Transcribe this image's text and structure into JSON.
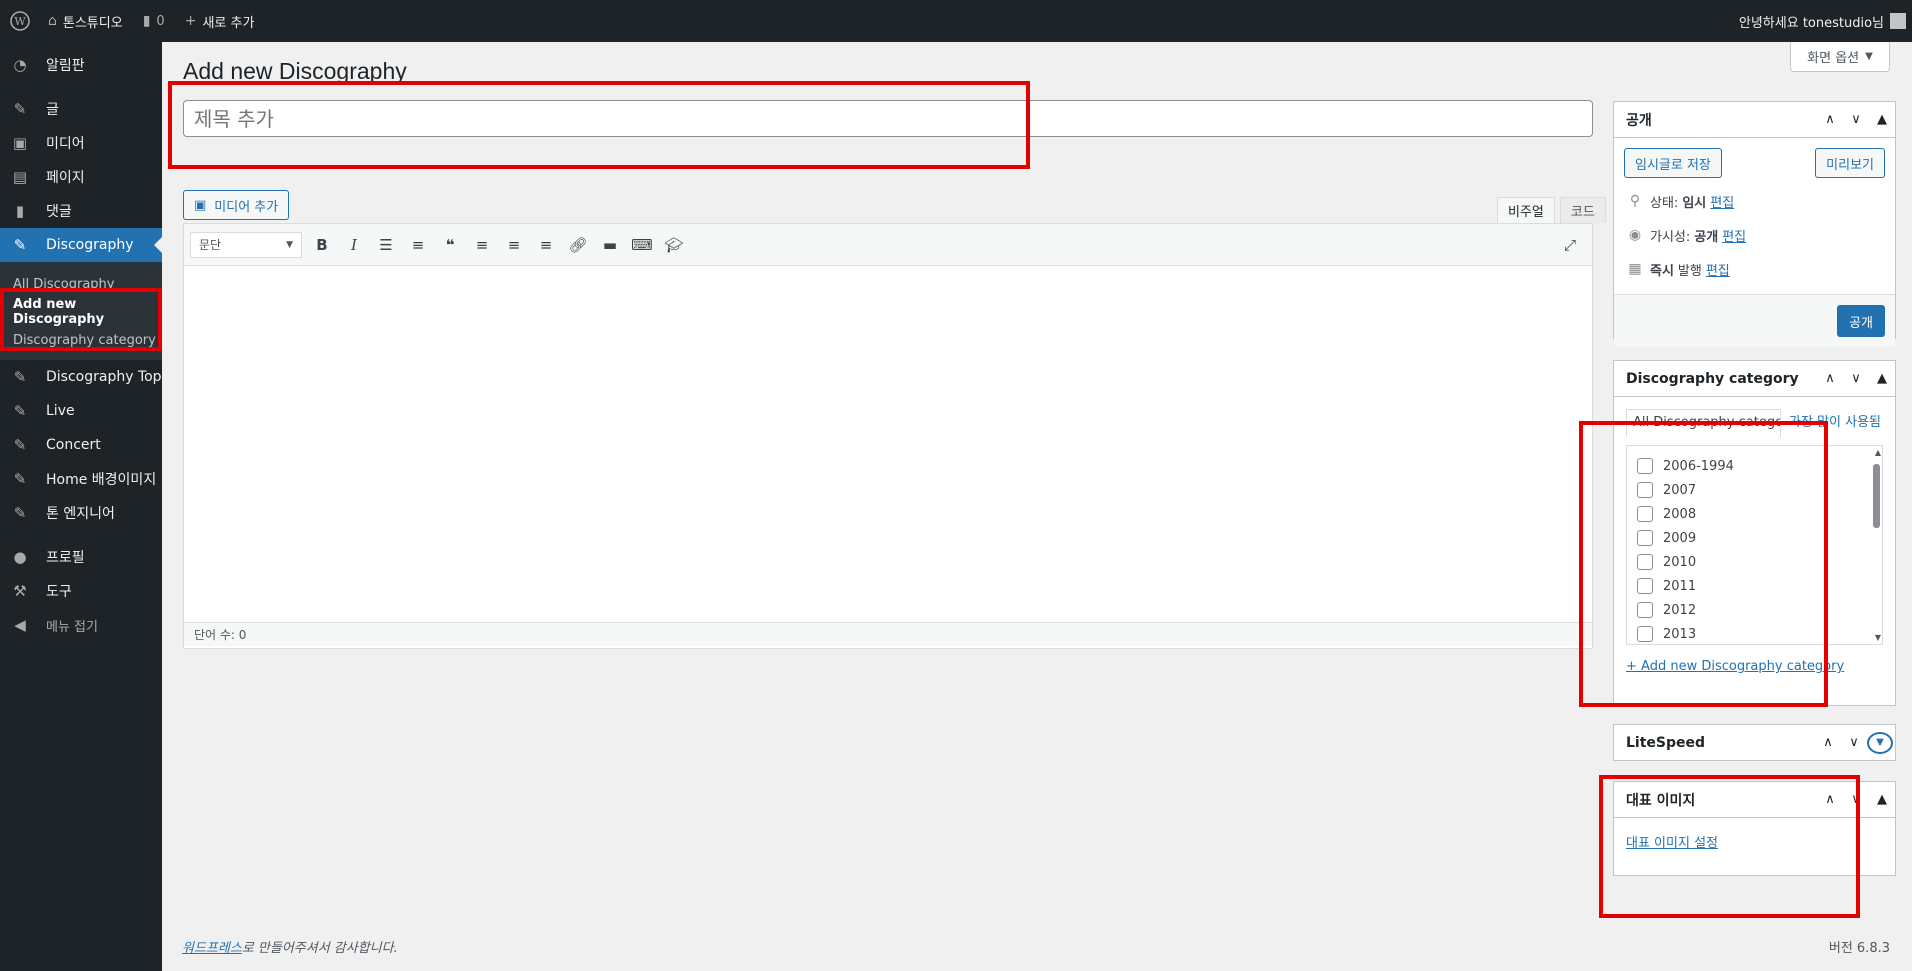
{
  "adminbar": {
    "site_name": "톤스튜디오",
    "comments_count": "0",
    "new_label": "새로 추가",
    "greeting": "안녕하세요 tonestudio님"
  },
  "sidebar": {
    "items": [
      {
        "label": "알림판",
        "icon": "dashboard-icon"
      },
      {
        "label": "글",
        "icon": "pin-icon"
      },
      {
        "label": "미디어",
        "icon": "media-icon"
      },
      {
        "label": "페이지",
        "icon": "page-icon"
      },
      {
        "label": "댓글",
        "icon": "comment-icon"
      },
      {
        "label": "Discography",
        "icon": "pin-icon"
      }
    ],
    "submenu": [
      "All Discography",
      "Add new Discography",
      "Discography category"
    ],
    "items2": [
      {
        "label": "Discography Top",
        "icon": "pin-icon"
      },
      {
        "label": "Live",
        "icon": "pin-icon"
      },
      {
        "label": "Concert",
        "icon": "pin-icon"
      },
      {
        "label": "Home 배경이미지",
        "icon": "pin-icon"
      },
      {
        "label": "톤 엔지니어",
        "icon": "pin-icon"
      }
    ],
    "items3": [
      {
        "label": "프로필",
        "icon": "user-icon"
      },
      {
        "label": "도구",
        "icon": "wrench-icon"
      }
    ],
    "collapse_label": "메뉴 접기"
  },
  "main": {
    "screen_options": "화면 옵션",
    "page_title": "Add new Discography",
    "title_placeholder": "제목 추가",
    "add_media": "미디어 추가",
    "tabs": {
      "visual": "비주얼",
      "code": "코드"
    },
    "format_select": "문단",
    "word_count": "단어 수: 0"
  },
  "publish": {
    "title": "공개",
    "save_draft": "임시글로 저장",
    "preview": "미리보기",
    "status_label": "상태:",
    "status_value": "임시",
    "visibility_label": "가시성:",
    "visibility_value": "공개",
    "publish_time_value": "즉시",
    "publish_time_label": "발행",
    "edit": "편집",
    "publish_button": "공개"
  },
  "category": {
    "title": "Discography category",
    "tab_all": "All Discography category",
    "tab_popular": "가장 많이 사용됨",
    "items": [
      "2006-1994",
      "2007",
      "2008",
      "2009",
      "2010",
      "2011",
      "2012",
      "2013"
    ],
    "add_link": "+ Add new Discography category"
  },
  "litespeed": {
    "title": "LiteSpeed"
  },
  "featured": {
    "title": "대표 이미지",
    "set_link": "대표 이미지 설정"
  },
  "footer": {
    "thanks_link": "워드프레스",
    "thanks_rest": "로 만들어주셔서 감사합니다.",
    "version": "버전 6.8.3"
  },
  "colors": {
    "accent": "#2271b1",
    "sidebar_bg": "#1d2327",
    "highlight": "#e30000"
  }
}
